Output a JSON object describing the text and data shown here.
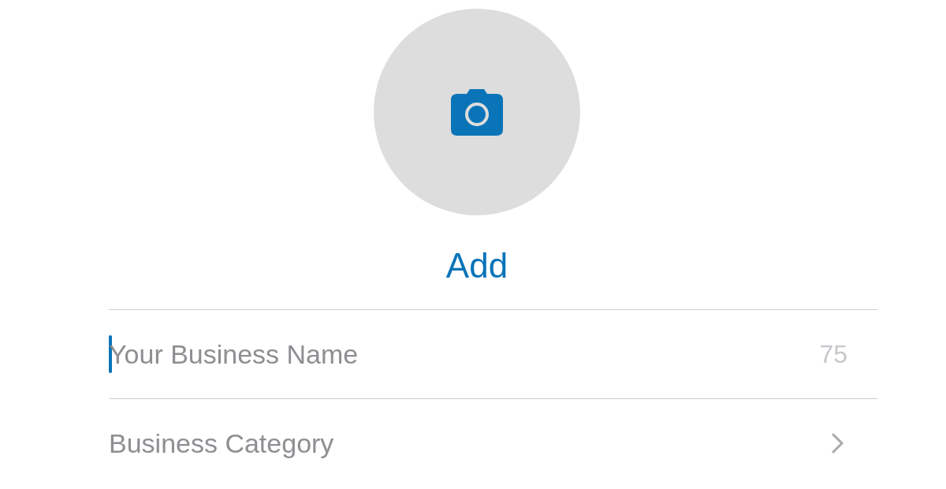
{
  "photo_button": {
    "label": "Add"
  },
  "business_name": {
    "placeholder": "Your Business Name",
    "counter": "75",
    "focused": true
  },
  "business_category": {
    "label": "Business Category"
  }
}
